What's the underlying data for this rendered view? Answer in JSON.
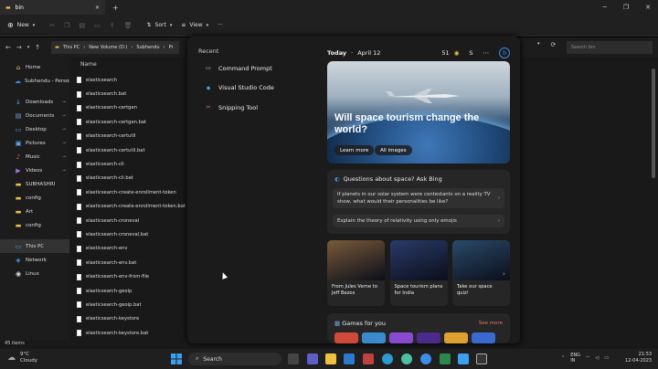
{
  "window": {
    "tab_title": "bin",
    "tab_close": "✕",
    "new_tab": "+"
  },
  "toolbar": {
    "new_label": "New",
    "sort_label": "Sort",
    "view_label": "View",
    "more": "···"
  },
  "address": {
    "crumbs": [
      "This PC",
      "New Volume (D:)",
      "Subhendu",
      "Pr"
    ],
    "search_placeholder": "Search bin"
  },
  "sidebar": {
    "items": [
      {
        "label": "Home",
        "icon": "home-icon",
        "glyph": "⌂",
        "color": "#f0c040"
      },
      {
        "label": "Subhendu - Persona",
        "icon": "cloud-icon",
        "glyph": "☁",
        "color": "#3b8ee8"
      },
      {
        "label": "Downloads",
        "icon": "download-icon",
        "glyph": "↓",
        "color": "#4fb3ff",
        "pinned": true
      },
      {
        "label": "Documents",
        "icon": "documents-icon",
        "glyph": "▤",
        "color": "#6fa8dc",
        "pinned": true
      },
      {
        "label": "Desktop",
        "icon": "desktop-icon",
        "glyph": "▭",
        "color": "#4a9ad9",
        "pinned": true
      },
      {
        "label": "Pictures",
        "icon": "pictures-icon",
        "glyph": "▣",
        "color": "#5ab0ff",
        "pinned": true
      },
      {
        "label": "Music",
        "icon": "music-icon",
        "glyph": "♪",
        "color": "#e0704a",
        "pinned": true
      },
      {
        "label": "Videos",
        "icon": "videos-icon",
        "glyph": "▶",
        "color": "#a070e0",
        "pinned": true
      },
      {
        "label": "SUBHASHRI",
        "icon": "folder-icon",
        "glyph": "▬",
        "color": "#f0c040"
      },
      {
        "label": "config",
        "icon": "folder-icon",
        "glyph": "▬",
        "color": "#f0c040"
      },
      {
        "label": "Art",
        "icon": "folder-icon",
        "glyph": "▬",
        "color": "#f0c040"
      },
      {
        "label": "config",
        "icon": "folder-icon",
        "glyph": "▬",
        "color": "#f0c040"
      },
      {
        "label": "This PC",
        "icon": "computer-icon",
        "glyph": "▭",
        "color": "#4a9ad9"
      },
      {
        "label": "Network",
        "icon": "network-icon",
        "glyph": "◈",
        "color": "#4a9ad9"
      },
      {
        "label": "Linux",
        "icon": "linux-icon",
        "glyph": "◉",
        "color": "#dddddd"
      }
    ]
  },
  "files": {
    "column_header": "Name",
    "items": [
      "elasticsearch",
      "elasticsearch.bat",
      "elasticsearch-certgen",
      "elasticsearch-certgen.bat",
      "elasticsearch-certutil",
      "elasticsearch-certutil.bat",
      "elasticsearch-cli",
      "elasticsearch-cli.bat",
      "elasticsearch-create-enrollment-token",
      "elasticsearch-create-enrollment-token.bat",
      "elasticsearch-croneval",
      "elasticsearch-croneval.bat",
      "elasticsearch-env",
      "elasticsearch-env.bat",
      "elasticsearch-env-from-file",
      "elasticsearch-geoip",
      "elasticsearch-geoip.bat",
      "elasticsearch-keystore",
      "elasticsearch-keystore.bat"
    ]
  },
  "status": {
    "items_count": "45 items"
  },
  "widgets": {
    "recent_title": "Recent",
    "recent": [
      {
        "label": "Command Prompt",
        "icon": "terminal-icon",
        "glyph": "▭",
        "color": "#cccccc"
      },
      {
        "label": "Visual Studio Code",
        "icon": "vscode-icon",
        "glyph": "◆",
        "color": "#3ba0f0"
      },
      {
        "label": "Snipping Tool",
        "icon": "snipping-tool-icon",
        "glyph": "✂",
        "color": "#e87a6a"
      }
    ],
    "header": {
      "today": "Today",
      "date": "April 12",
      "temp": "51",
      "avatar": "S"
    },
    "hero": {
      "title": "Will space tourism change the world?",
      "learn_more": "Learn more",
      "all_images": "All images"
    },
    "bing": {
      "title": "Questions about space? Ask Bing",
      "questions": [
        "If planets in our solar system were contestants on a reality TV show, what would their personalities be like?",
        "Explain the theory of relativity using only emojis"
      ]
    },
    "cards": [
      {
        "text": "From Jules Verne to Jeff Bezos",
        "color": "#7a5a3a"
      },
      {
        "text": "Space tourism plans for India",
        "color": "#2a3a6a"
      },
      {
        "text": "Take our space quiz!",
        "color": "#2a4a6a"
      }
    ],
    "games": {
      "title": "Games for you",
      "see_more": "See more"
    }
  },
  "taskbar": {
    "weather_temp": "9°C",
    "weather_desc": "Cloudy",
    "search_label": "Search",
    "lang": "ENG",
    "region": "IN",
    "time": "21:53",
    "date": "12-04-2023"
  },
  "colors": {
    "accent": "#3b8ee8",
    "see_more": "#e07a5f"
  }
}
